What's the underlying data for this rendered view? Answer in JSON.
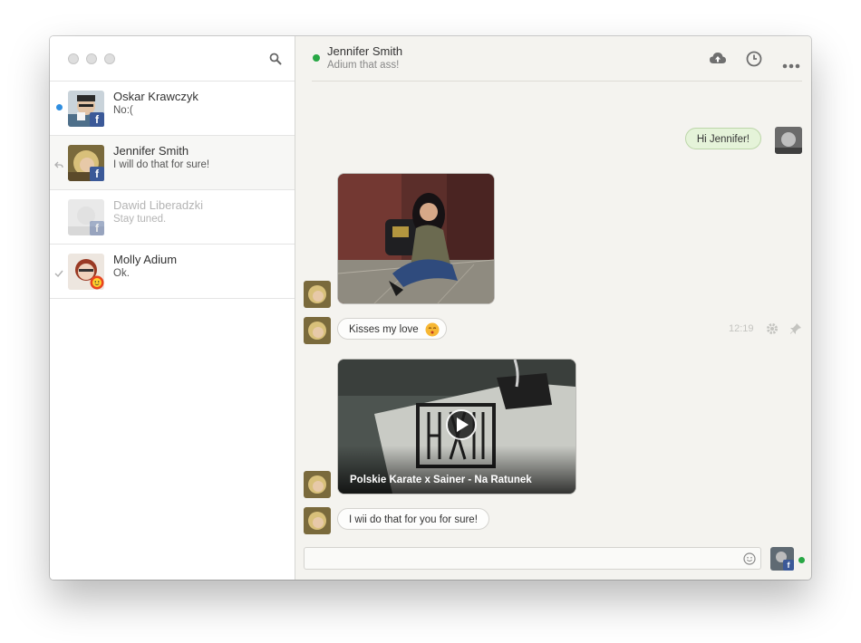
{
  "contacts": [
    {
      "name": "Oskar Krawczyk",
      "message": "No:(",
      "network": "facebook",
      "status": "unread"
    },
    {
      "name": "Jennifer Smith",
      "message": "I will do that for sure!",
      "network": "facebook",
      "status": "replied",
      "selected": true
    },
    {
      "name": "Dawid Liberadzki",
      "message": "Stay tuned.",
      "network": "facebook",
      "status": "offline"
    },
    {
      "name": "Molly Adium",
      "message": "Ok.",
      "network": "adium",
      "status": "read"
    }
  ],
  "chat": {
    "contact_name": "Jennifer Smith",
    "contact_status": "Adium that ass!",
    "online": true
  },
  "messages": {
    "outgoing_1": "Hi Jennifer!",
    "incoming_2": "Kisses my love",
    "incoming_2_time": "12:19",
    "video_title": "Polskie Karate x Sainer - Na Ratunek",
    "incoming_4": "I wii do that for you for sure!"
  },
  "composer": {
    "placeholder": ""
  },
  "colors": {
    "unread": "#2f8ee0",
    "online": "#28a745",
    "facebook": "#3b5998",
    "outgoing_bubble": "#e5f3d9"
  },
  "icons": {
    "search": "search-icon",
    "upload": "cloud-upload-icon",
    "history": "clock-icon",
    "more": "ellipsis-icon",
    "settings": "gear-icon",
    "pin": "pin-icon",
    "emoji": "smiley-icon",
    "reply": "reply-arrow-icon",
    "check": "checkmark-icon",
    "play": "play-icon"
  }
}
